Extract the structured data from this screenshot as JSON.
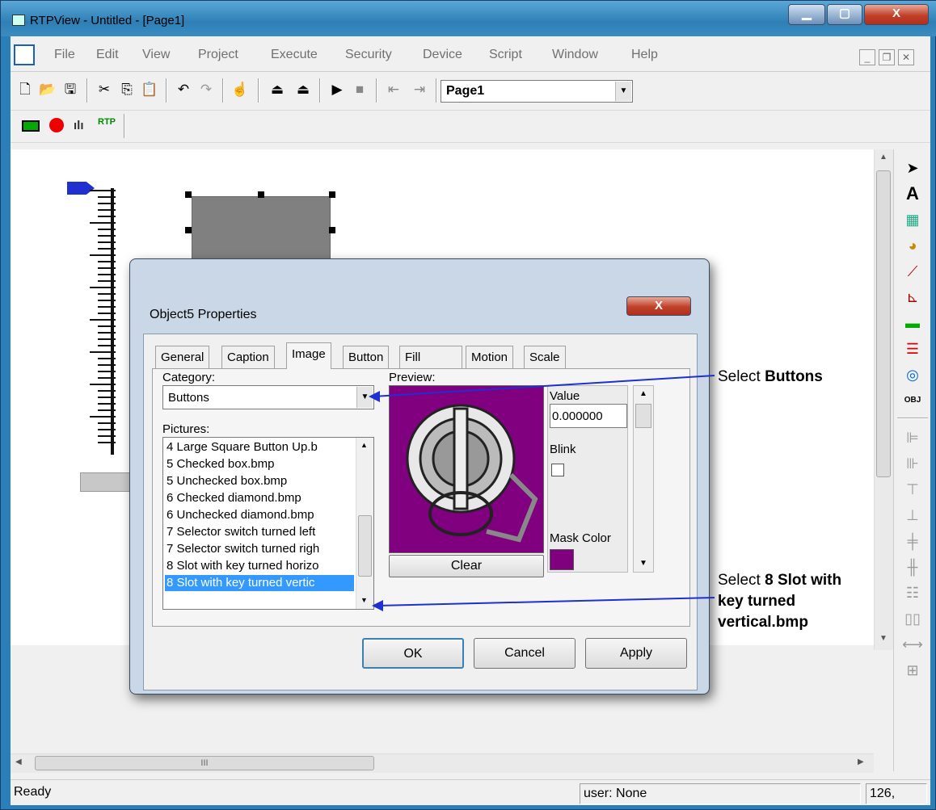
{
  "window": {
    "title": "RTPView  -  Untitled - [Page1]",
    "min": "▁",
    "max": "▢",
    "close": "X"
  },
  "menu": [
    "File",
    "Edit",
    "View",
    "Project",
    "Execute",
    "Security",
    "Device",
    "Script",
    "Window",
    "Help"
  ],
  "mdi": {
    "min": "_",
    "restore": "❐",
    "close": "✕"
  },
  "toolbar": {
    "page_select": "Page1"
  },
  "status": {
    "ready": "Ready",
    "user": "user: None",
    "coords": "126,"
  },
  "dialog": {
    "title": "Object5 Properties",
    "close": "X",
    "tabs": [
      "General",
      "Caption",
      "Image",
      "Button",
      "Fill",
      "Motion",
      "Scale"
    ],
    "active_tab": "Image",
    "category_label": "Category:",
    "category_value": "Buttons",
    "pictures_label": "Pictures:",
    "pictures": [
      "4 Large Square Button Up.b",
      "5 Checked box.bmp",
      "5 Unchecked box.bmp",
      "6 Checked diamond.bmp",
      "6 Unchecked diamond.bmp",
      "7 Selector switch turned left",
      "7 Selector switch turned righ",
      "8 Slot with key turned horizo",
      "8 Slot with key turned vertic"
    ],
    "selected_picture": "8 Slot with key turned vertic",
    "preview_label": "Preview:",
    "value_label": "Value",
    "value": "0.000000",
    "blink_label": "Blink",
    "mask_color_label": "Mask Color",
    "mask_color": "#800080",
    "clear": "Clear",
    "ok": "OK",
    "cancel": "Cancel",
    "apply": "Apply"
  },
  "annotations": {
    "a1_prefix": "Select ",
    "a1_bold": "Buttons",
    "a2_prefix": "Select ",
    "a2_bold1": "8 Slot with",
    "a2_bold2": "key turned",
    "a2_bold3": "vertical.bmp"
  },
  "scroll": {
    "hthumb_grip": "III"
  },
  "colors": {
    "accent": "#3399ff",
    "arrow": "#1f2fd0",
    "preview_bg": "#800080"
  }
}
